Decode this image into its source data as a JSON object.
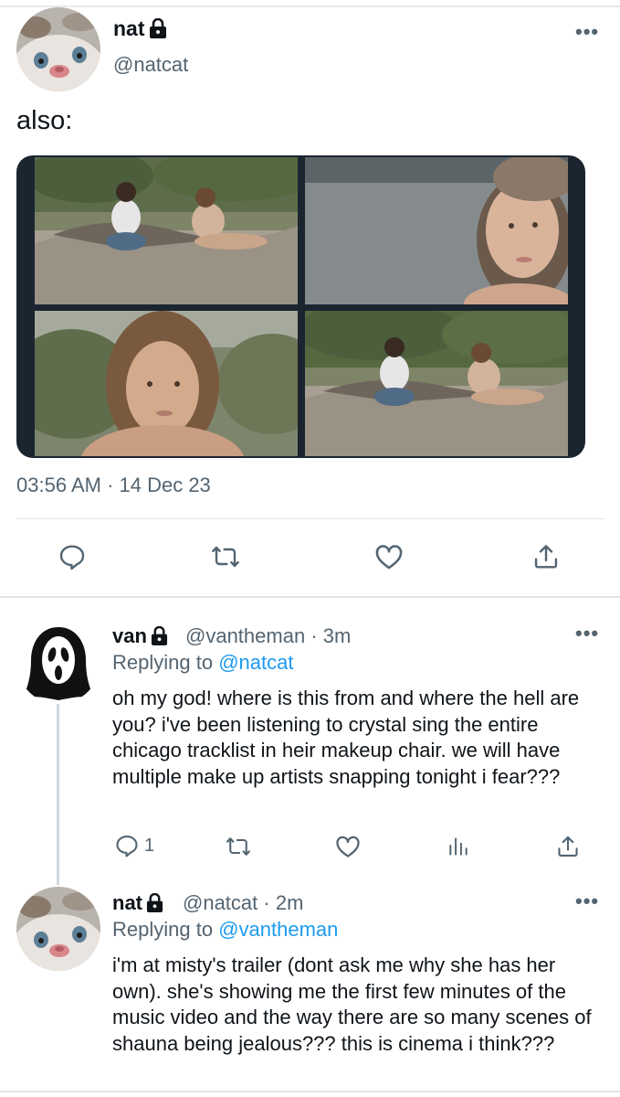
{
  "main_tweet": {
    "author_name": "nat",
    "author_handle": "@natcat",
    "protected_icon": "lock-icon",
    "text": "also:",
    "timestamp": "03:56 AM · 14 Dec 23",
    "media_count": 4,
    "actions": [
      "reply-icon",
      "retweet-icon",
      "like-icon",
      "share-icon"
    ]
  },
  "replies": [
    {
      "author_name": "van",
      "author_handle": "@vantheman",
      "time": "· 3m",
      "replying_prefix": "Replying to ",
      "replying_to": "@natcat",
      "text": "oh my god! where is this from and where the hell are you? i've been listening to crystal sing the entire chicago tracklist in heir makeup chair. we will have multiple make up artists snapping tonight i fear???",
      "reply_count": "1"
    },
    {
      "author_name": "nat",
      "author_handle": "@natcat",
      "time": "· 2m",
      "replying_prefix": "Replying to ",
      "replying_to": "@vantheman",
      "text": "i'm at misty's trailer (dont ask me why she has her own). she's showing me the first few minutes of the music video and the way there are so many scenes of shauna being jealous??? this is cinema i think???"
    }
  ],
  "colors": {
    "text": "#0f1419",
    "secondary": "#536471",
    "link": "#1d9bf0",
    "divider": "#e1e4e6"
  }
}
